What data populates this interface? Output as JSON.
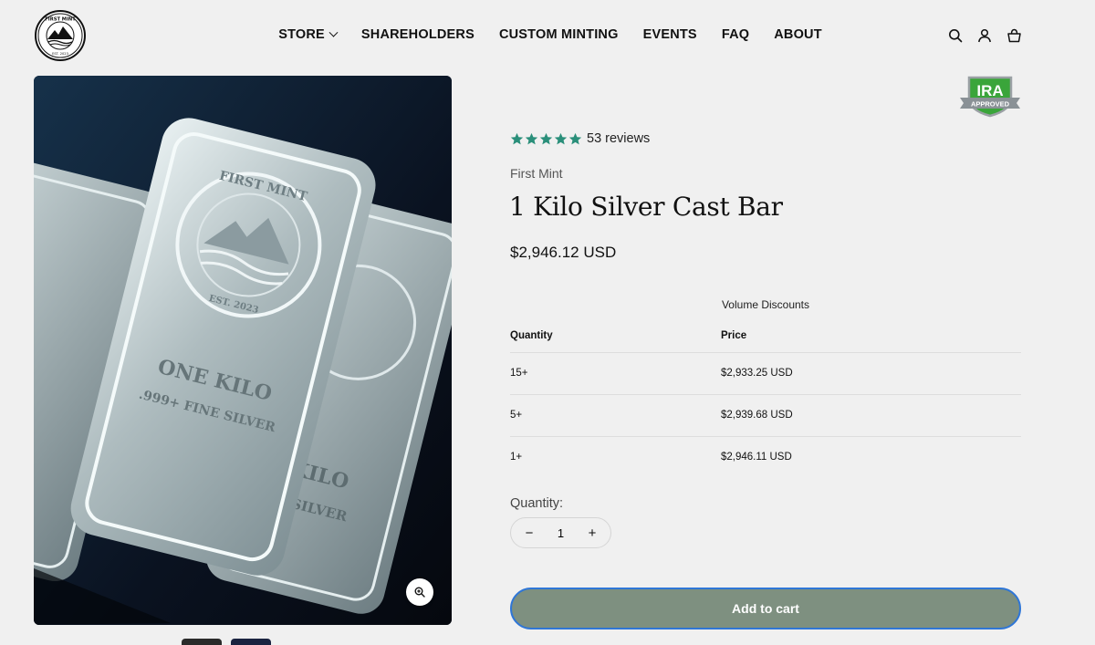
{
  "brand": {
    "logo_text": "FIRST MINT",
    "logo_est": "EST. 2023"
  },
  "nav": {
    "items": [
      {
        "label": "STORE",
        "has_dropdown": true
      },
      {
        "label": "SHAREHOLDERS"
      },
      {
        "label": "CUSTOM MINTING"
      },
      {
        "label": "EVENTS"
      },
      {
        "label": "FAQ"
      },
      {
        "label": "ABOUT"
      }
    ]
  },
  "header_icons": [
    "search-icon",
    "account-icon",
    "cart-icon"
  ],
  "image": {
    "bar_text_top": "FIRST MINT",
    "bar_text_est": "EST. 2023",
    "bar_text_weight": "ONE KILO",
    "bar_text_purity": ".999+ FINE SILVER",
    "bar_text_weight_back": "KILO",
    "bar_text_purity_back": "E SILVER"
  },
  "badge": {
    "line1": "IRA",
    "line2": "APPROVED",
    "color": "#3aa53a"
  },
  "product": {
    "rating": 5,
    "review_count": "53 reviews",
    "star_color": "#2a8f7a",
    "vendor": "First Mint",
    "title": "1 Kilo Silver Cast Bar",
    "price": "$2,946.12 USD"
  },
  "volume_discounts": {
    "caption": "Volume Discounts",
    "headers": {
      "quantity": "Quantity",
      "price": "Price"
    },
    "rows": [
      {
        "quantity": "15+",
        "price": "$2,933.25 USD"
      },
      {
        "quantity": "5+",
        "price": "$2,939.68 USD"
      },
      {
        "quantity": "1+",
        "price": "$2,946.11 USD"
      }
    ]
  },
  "quantity": {
    "label": "Quantity:",
    "value": "1",
    "minus": "−",
    "plus": "+"
  },
  "cart": {
    "add_label": "Add to cart",
    "button_color": "#7e9080"
  }
}
